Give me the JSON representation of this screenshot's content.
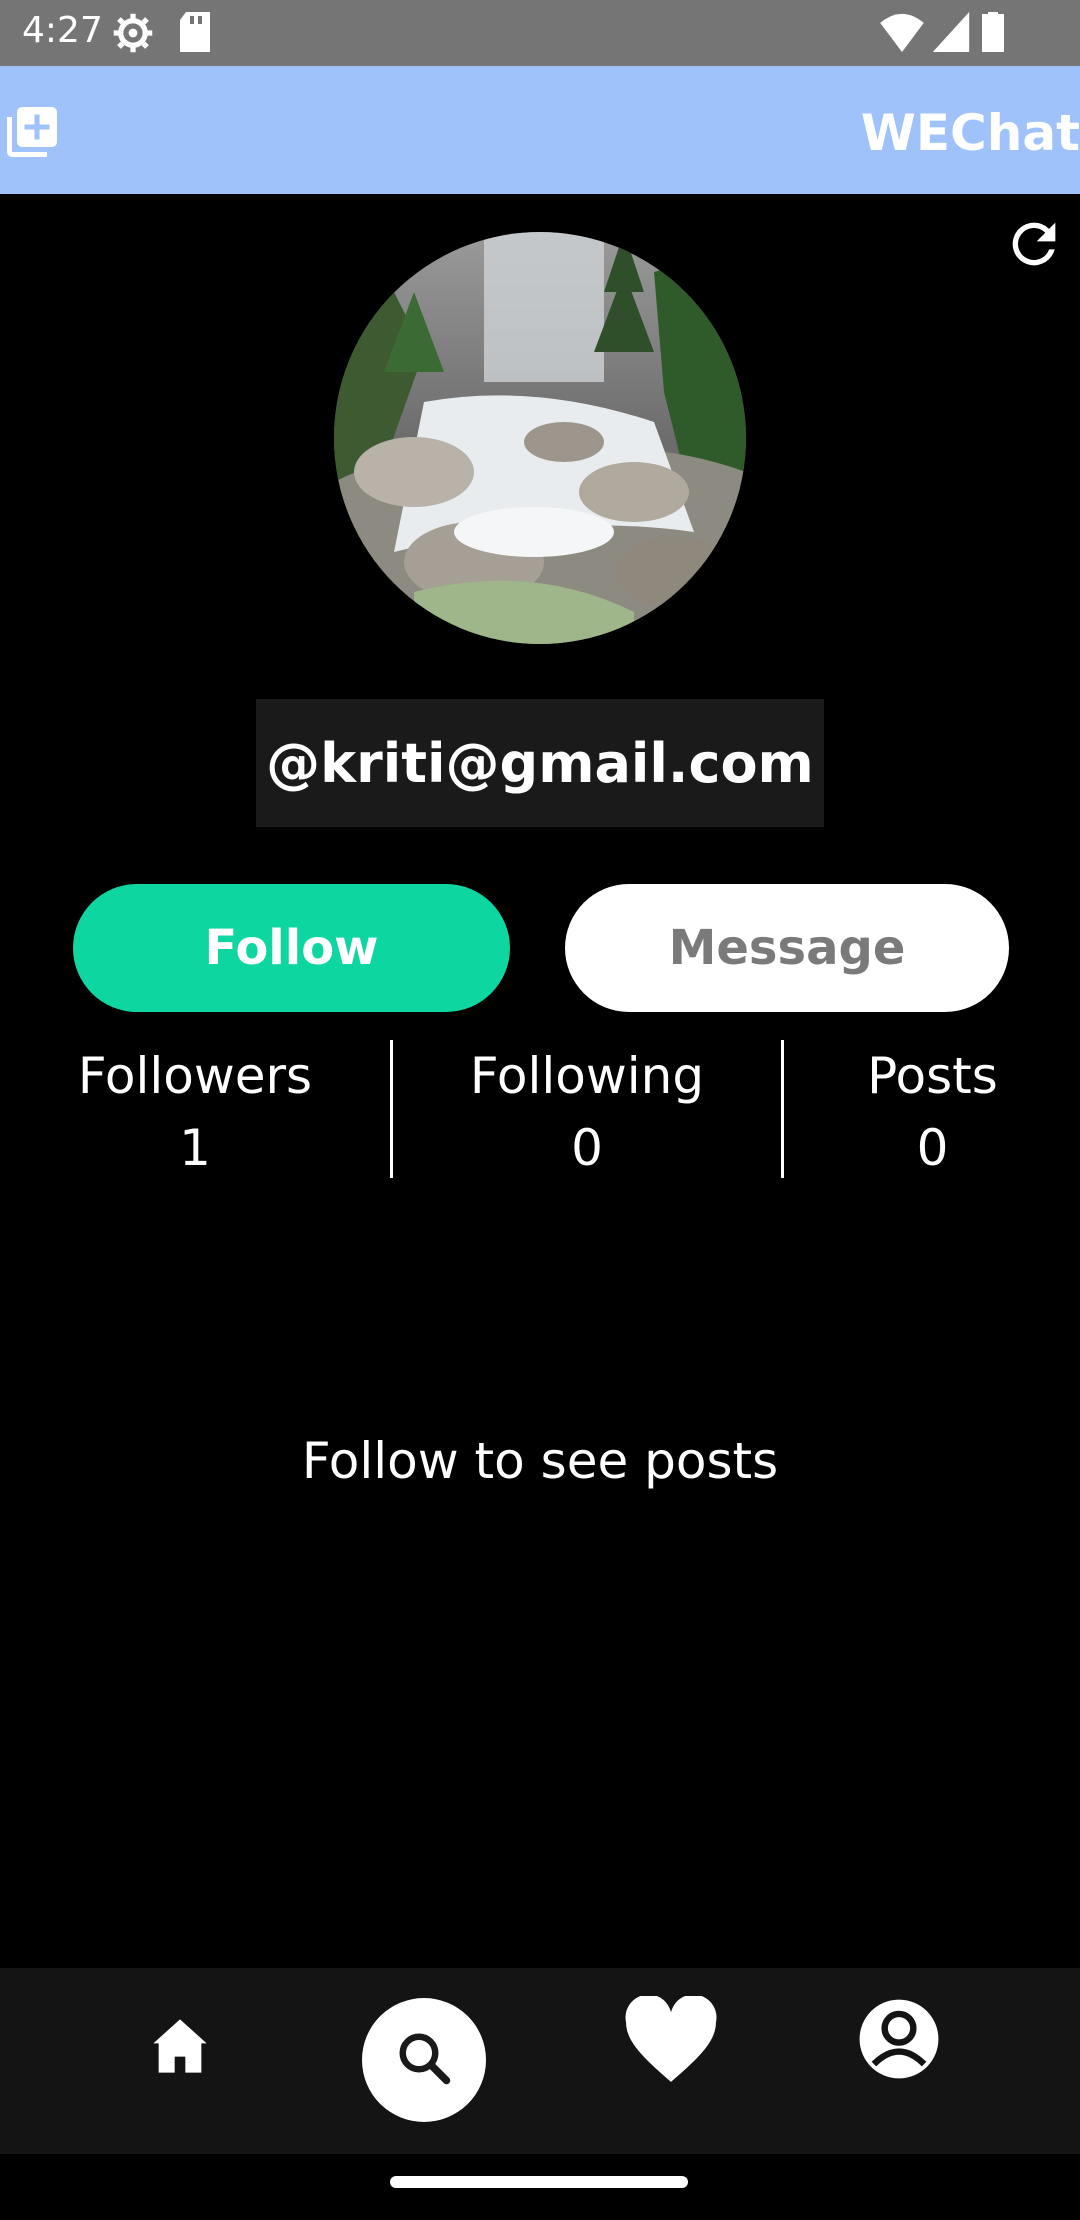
{
  "status_bar": {
    "time": "4:27",
    "icons": [
      "settings-icon",
      "sd-card-icon",
      "wifi-icon",
      "signal-icon",
      "battery-icon"
    ]
  },
  "app_bar": {
    "title": "WEChat",
    "add_icon": "add-post-icon",
    "background": "#a0c2fb"
  },
  "profile": {
    "refresh_icon": "refresh-icon",
    "avatar": "waterfall-river-rocks-photo",
    "username": "@kriti@gmail.com"
  },
  "actions": {
    "follow_label": "Follow",
    "message_label": "Message",
    "follow_color": "#0dd6a0"
  },
  "stats": [
    {
      "label": "Followers",
      "count": "1"
    },
    {
      "label": "Following",
      "count": "0"
    },
    {
      "label": "Posts",
      "count": "0"
    }
  ],
  "posts": {
    "empty_message": "Follow to see posts"
  },
  "bottom_nav": {
    "items": [
      "home-icon",
      "search-icon",
      "heart-icon",
      "profile-icon"
    ],
    "active": "search-icon"
  }
}
